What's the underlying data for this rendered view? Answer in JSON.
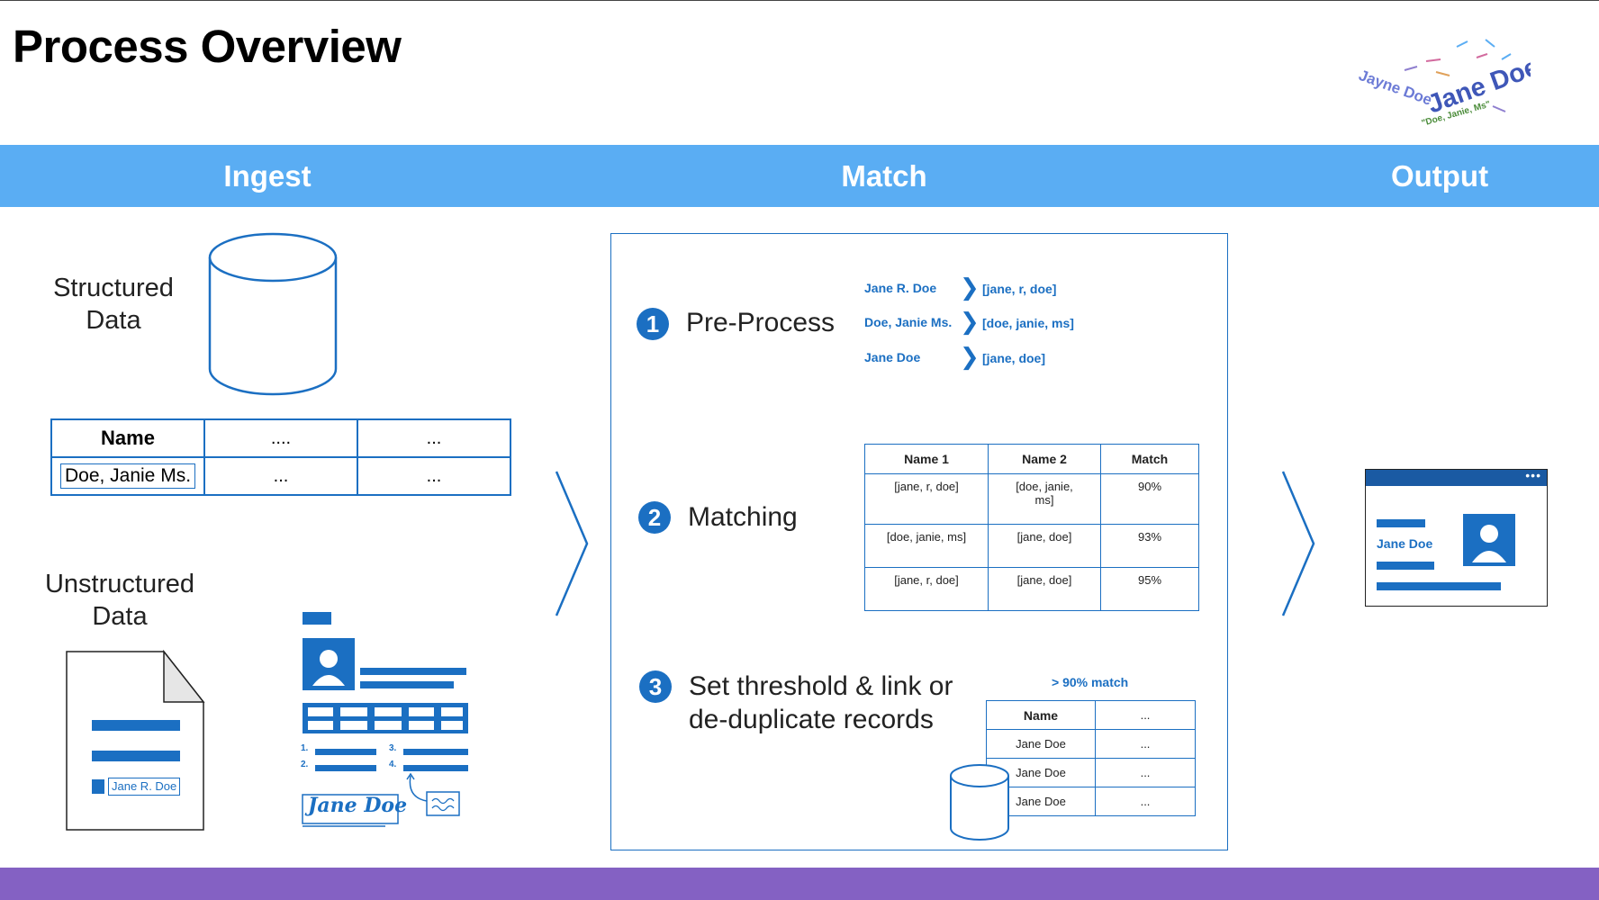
{
  "title": "Process Overview",
  "logo_words": [
    "Jayne Doe",
    "Jane Doe",
    "\"Doe, Janie, Ms\""
  ],
  "phases": [
    "Ingest",
    "Match",
    "Output"
  ],
  "ingest": {
    "structured_label": [
      "Structured",
      "Data"
    ],
    "table": {
      "header": [
        "Name",
        "....",
        "..."
      ],
      "row": [
        "Doe, Janie Ms.",
        "...",
        "..."
      ]
    },
    "unstructured_label": [
      "Unstructured",
      "Data"
    ],
    "doc_name": "Jane R. Doe",
    "form_list_nums": [
      "1.",
      "2.",
      "3.",
      "4."
    ],
    "signature": "Jane Doe"
  },
  "match": {
    "steps": [
      {
        "num": "1",
        "label": "Pre-Process"
      },
      {
        "num": "2",
        "label": "Matching"
      },
      {
        "num": "3",
        "label": "Set threshold & link or",
        "label2": "de-duplicate records"
      }
    ],
    "preprocess": [
      {
        "input": "Jane R. Doe",
        "output": "[jane, r, doe]"
      },
      {
        "input": "Doe, Janie Ms.",
        "output": "[doe, janie, ms]"
      },
      {
        "input": "Jane Doe",
        "output": "[jane, doe]"
      }
    ],
    "match_table": {
      "header": [
        "Name 1",
        "Name 2",
        "Match"
      ],
      "rows": [
        [
          "[jane, r, doe]",
          "[doe, janie, ms]",
          "90%"
        ],
        [
          "[doe, janie, ms]",
          "[jane, doe]",
          "93%"
        ],
        [
          "[jane, r, doe]",
          "[jane, doe]",
          "95%"
        ]
      ]
    },
    "threshold_label": "> 90% match",
    "dedupe_table": {
      "header": [
        "Name",
        "..."
      ],
      "rows": [
        [
          "Jane Doe",
          "..."
        ],
        [
          "Jane Doe",
          "..."
        ],
        [
          "Jane Doe",
          "..."
        ]
      ]
    }
  },
  "output": {
    "card_name": "Jane Doe",
    "menu_dots": "•••"
  },
  "colors": {
    "accent": "#1b6fc2",
    "band": "#5aadf3",
    "footer": "#8461c3"
  }
}
